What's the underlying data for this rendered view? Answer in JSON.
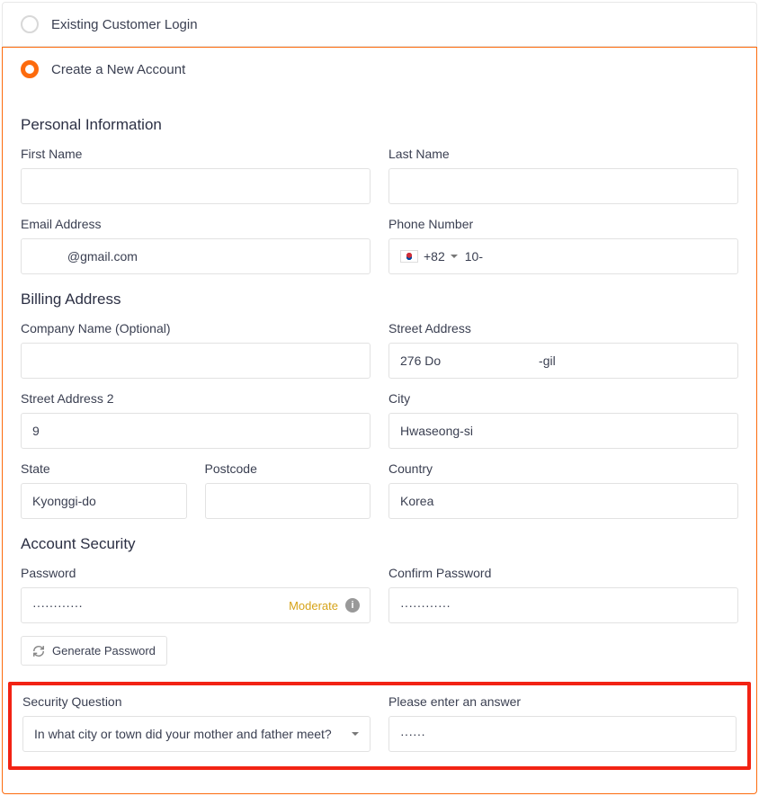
{
  "options": {
    "existing_label": "Existing Customer Login",
    "create_label": "Create a New Account"
  },
  "sections": {
    "personal": "Personal Information",
    "billing": "Billing Address",
    "security": "Account Security"
  },
  "personal": {
    "first_name_label": "First Name",
    "first_name_value": "",
    "last_name_label": "Last Name",
    "last_name_value": "",
    "email_label": "Email Address",
    "email_value": "          @gmail.com",
    "phone_label": "Phone Number",
    "phone_code": "+82",
    "phone_value": "10-"
  },
  "billing": {
    "company_label": "Company Name (Optional)",
    "company_value": "",
    "street1_label": "Street Address",
    "street1_value": "276 Do                            -gil",
    "street2_label": "Street Address 2",
    "street2_value": "9",
    "city_label": "City",
    "city_value": "Hwaseong-si",
    "state_label": "State",
    "state_value": "Kyonggi-do",
    "postcode_label": "Postcode",
    "postcode_value": "",
    "country_label": "Country",
    "country_value": "Korea"
  },
  "security": {
    "password_label": "Password",
    "password_value": "············",
    "password_strength": "Moderate",
    "confirm_label": "Confirm Password",
    "confirm_value": "············",
    "generate_label": "Generate Password",
    "question_label": "Security Question",
    "question_value": "In what city or town did your mother and father meet?",
    "answer_label": "Please enter an answer",
    "answer_value": "······"
  }
}
